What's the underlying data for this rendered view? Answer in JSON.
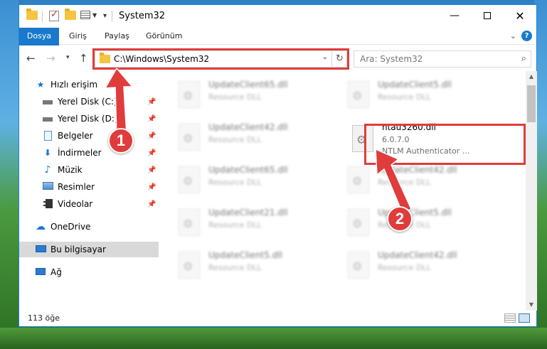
{
  "window": {
    "title": "System32"
  },
  "ribbon": {
    "tabs": [
      "Dosya",
      "Giriş",
      "Paylaş",
      "Görünüm"
    ]
  },
  "nav": {
    "address": "C:\\Windows\\System32",
    "search_placeholder": "Ara: System32"
  },
  "sidebar": {
    "items": [
      {
        "label": "Hızlı erişim",
        "icon": "star-icon"
      },
      {
        "label": "Yerel Disk (C:)",
        "icon": "drive-icon"
      },
      {
        "label": "Yerel Disk (D:)",
        "icon": "drive-icon"
      },
      {
        "label": "Belgeler",
        "icon": "documents-icon"
      },
      {
        "label": "İndirmeler",
        "icon": "download-icon"
      },
      {
        "label": "Müzik",
        "icon": "music-icon"
      },
      {
        "label": "Resimler",
        "icon": "pictures-icon"
      },
      {
        "label": "Videolar",
        "icon": "videos-icon"
      },
      {
        "label": "OneDrive",
        "icon": "cloud-icon"
      },
      {
        "label": "Bu bilgisayar",
        "icon": "computer-icon"
      },
      {
        "label": "Ağ",
        "icon": "network-icon"
      }
    ]
  },
  "files": {
    "left": [
      {
        "name": "UpdateClient65.dll",
        "type": "Resource DLL"
      },
      {
        "name": "UpdateClient42.dll",
        "type": "Resource DLL"
      },
      {
        "name": "UpdateClient65.dll",
        "type": "Resource DLL"
      },
      {
        "name": "UpdateClient21.dll",
        "type": "Resource DLL"
      },
      {
        "name": "UpdateClient5.dll",
        "type": "Resource DLL"
      }
    ],
    "right": [
      {
        "name": "UpdateClient5.dll",
        "type": "Resource DLL"
      },
      {
        "name": "ntau3260.dll",
        "version": "6.0.7.0",
        "description": "NTLM Authenticator ..."
      },
      {
        "name": "UpdateClient42.dll",
        "type": "Resource DLL"
      },
      {
        "name": "UpdateClient5.dll",
        "type": "Resource DLL"
      },
      {
        "name": "UpdateClient42.dll",
        "type": "Resource DLL"
      }
    ]
  },
  "status": {
    "count": "113 öğe"
  },
  "annotations": {
    "badge1": "1",
    "badge2": "2",
    "color": "#e03c3c"
  }
}
